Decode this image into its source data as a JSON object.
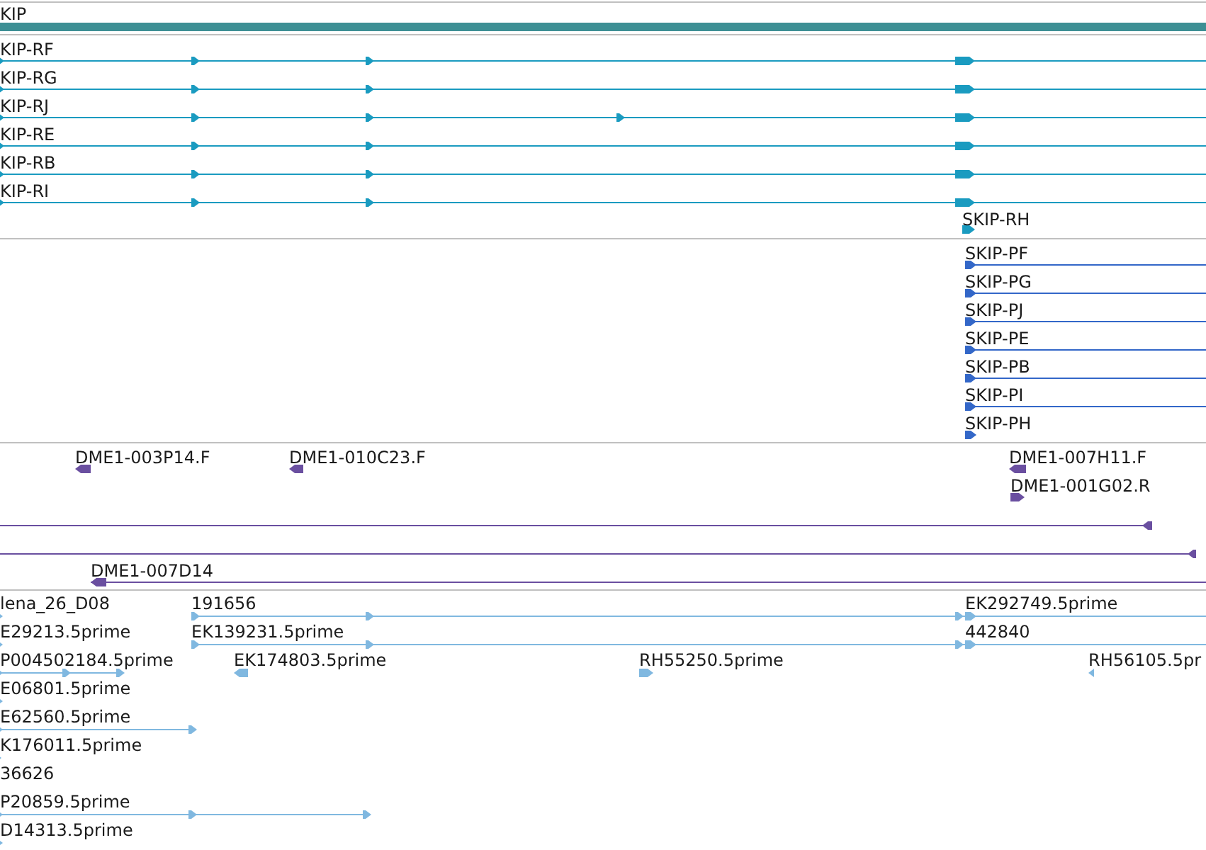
{
  "tracks": [
    {
      "kind": "gene",
      "color": "#3d8f94",
      "features": [
        {
          "label": "KIP"
        }
      ]
    },
    {
      "kind": "transcript",
      "color": "#1a9bc0",
      "features": [
        {
          "label": "KIP-RF",
          "reverse": false
        },
        {
          "label": "KIP-RG",
          "reverse": false
        },
        {
          "label": "KIP-RJ",
          "reverse": false
        },
        {
          "label": "KIP-RE",
          "reverse": false
        },
        {
          "label": "KIP-RB",
          "reverse": false
        },
        {
          "label": "KIP-RI",
          "reverse": false
        },
        {
          "label": "SKIP-RH",
          "reverse": false
        }
      ]
    },
    {
      "kind": "protein",
      "color": "#3367c8",
      "features": [
        {
          "label": "SKIP-PF",
          "reverse": false
        },
        {
          "label": "SKIP-PG",
          "reverse": false
        },
        {
          "label": "SKIP-PJ",
          "reverse": false
        },
        {
          "label": "SKIP-PE",
          "reverse": false
        },
        {
          "label": "SKIP-PB",
          "reverse": false
        },
        {
          "label": "SKIP-PI",
          "reverse": false
        },
        {
          "label": "SKIP-PH",
          "reverse": false
        }
      ]
    },
    {
      "kind": "clone",
      "color": "#6a4fa0",
      "features": [
        {
          "label": "DME1-003P14.F",
          "reverse": true
        },
        {
          "label": "DME1-010C23.F",
          "reverse": true
        },
        {
          "label": "DME1-007H11.F",
          "reverse": true
        },
        {
          "label": "DME1-001G02.R",
          "reverse": false
        },
        {
          "reverse": true
        },
        {
          "reverse": true
        },
        {
          "label": "DME1-007D14",
          "reverse": true
        }
      ]
    },
    {
      "kind": "est",
      "color": "#80b8e0",
      "features": [
        {
          "label": "lena_26_D08",
          "reverse": false
        },
        {
          "label": "191656",
          "reverse": false
        },
        {
          "label": "EK292749.5prime",
          "reverse": false
        },
        {
          "label": "E29213.5prime",
          "reverse": false
        },
        {
          "label": "EK139231.5prime",
          "reverse": false
        },
        {
          "label": "442840",
          "reverse": false
        },
        {
          "label": "P004502184.5prime",
          "reverse": false
        },
        {
          "label": "EK174803.5prime",
          "reverse": true
        },
        {
          "label": "RH55250.5prime",
          "reverse": false
        },
        {
          "label": "RH56105.5pr",
          "reverse": true
        },
        {
          "label": "E06801.5prime",
          "reverse": false
        },
        {
          "label": "E62560.5prime",
          "reverse": false
        },
        {
          "label": "K176011.5prime",
          "reverse": false
        },
        {
          "label": "36626"
        },
        {
          "label": "P20859.5prime",
          "reverse": false
        },
        {
          "label": "D14313.5prime",
          "reverse": false
        }
      ]
    }
  ]
}
